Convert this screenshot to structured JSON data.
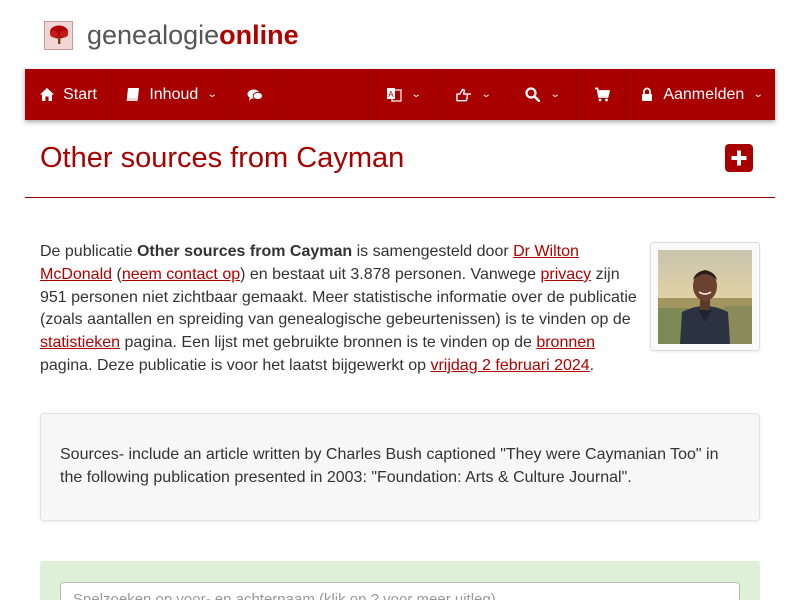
{
  "header": {
    "brand_part1": "genealogie",
    "brand_part2": "online",
    "logo_icon": "tree-icon"
  },
  "nav": {
    "start_label": "Start",
    "inhoud_label": "Inhoud",
    "aanmelden_label": "Aanmelden",
    "icons": [
      "home-icon",
      "book-icon",
      "comments-icon",
      "translate-icon",
      "hand-pointer-icon",
      "search-icon",
      "shopping-cart-icon",
      "lock-icon"
    ]
  },
  "page": {
    "title": "Other sources from Cayman"
  },
  "intro": {
    "t1": "De publicatie ",
    "pub_name": "Other sources from Cayman",
    "t2": " is samengesteld door ",
    "author_link": "Dr Wilton McDonald",
    "t3": " (",
    "contact_link": "neem contact op",
    "t4": ") en bestaat uit 3.878 personen. Vanwege ",
    "privacy_link": "privacy",
    "t5": " zijn 951 personen niet zichtbaar gemaakt. Meer statistische informatie over de publicatie (zoals aantallen en spreiding van genealogische gebeurtenissen) is te vinden op de ",
    "stats_link": "statistieken",
    "t6": " pagina. Een lijst met gebruikte bronnen is te vinden op de ",
    "sources_link": "bronnen",
    "t7": " pagina. Deze publicatie is voor het laatst bijgewerkt op ",
    "date_link": "vrijdag 2 februari 2024",
    "t8": "."
  },
  "sources_text": "Sources-  include an article written by Charles Bush captioned  \"They were Caymanian Too\" in the following publication presented in 2003:  \"Foundation: Arts & Culture Journal\".",
  "search": {
    "placeholder": "Snelzoeken op voor- en achternaam (klik op ? voor meer uitleg)"
  },
  "colors": {
    "brand_red": "#a80000",
    "link_red": "#b00000",
    "search_panel_green": "#dff0d8"
  }
}
